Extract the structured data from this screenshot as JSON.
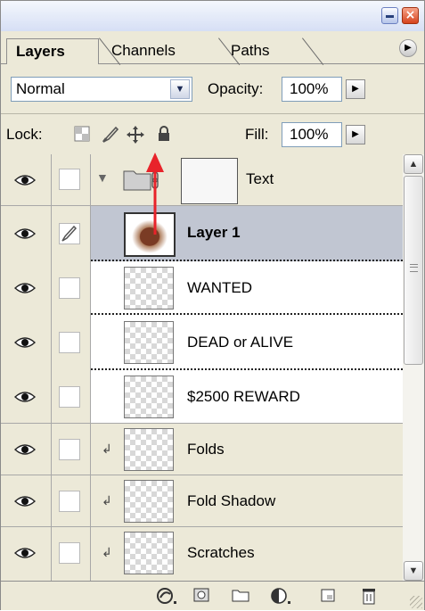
{
  "panel": {
    "tabs": [
      "Layers",
      "Channels",
      "Paths"
    ]
  },
  "window": {
    "close_glyph": "×"
  },
  "blend": {
    "mode": "Normal",
    "opacity_label": "Opacity:",
    "opacity_value": "100%"
  },
  "lock": {
    "label": "Lock:",
    "fill_label": "Fill:",
    "fill_value": "100%"
  },
  "layers": [
    {
      "name": "Text",
      "kind": "group"
    },
    {
      "name": "Layer 1",
      "kind": "layer",
      "selected": true,
      "bold": true
    },
    {
      "name": "WANTED",
      "kind": "text-child"
    },
    {
      "name": "DEAD or ALIVE",
      "kind": "text-child"
    },
    {
      "name": "$2500 REWARD",
      "kind": "text-child"
    },
    {
      "name": "Folds",
      "kind": "clipped"
    },
    {
      "name": "Fold Shadow",
      "kind": "clipped"
    },
    {
      "name": "Scratches",
      "kind": "clipped"
    }
  ],
  "bottom_icons": [
    "link-layers-icon",
    "layer-mask-icon",
    "new-group-icon",
    "adjustment-layer-icon",
    "new-layer-icon",
    "trash-icon"
  ],
  "colors": {
    "panel_bg": "#ece9d8",
    "selected_row": "#c1c6d2",
    "annotation_arrow": "#e8232a"
  }
}
